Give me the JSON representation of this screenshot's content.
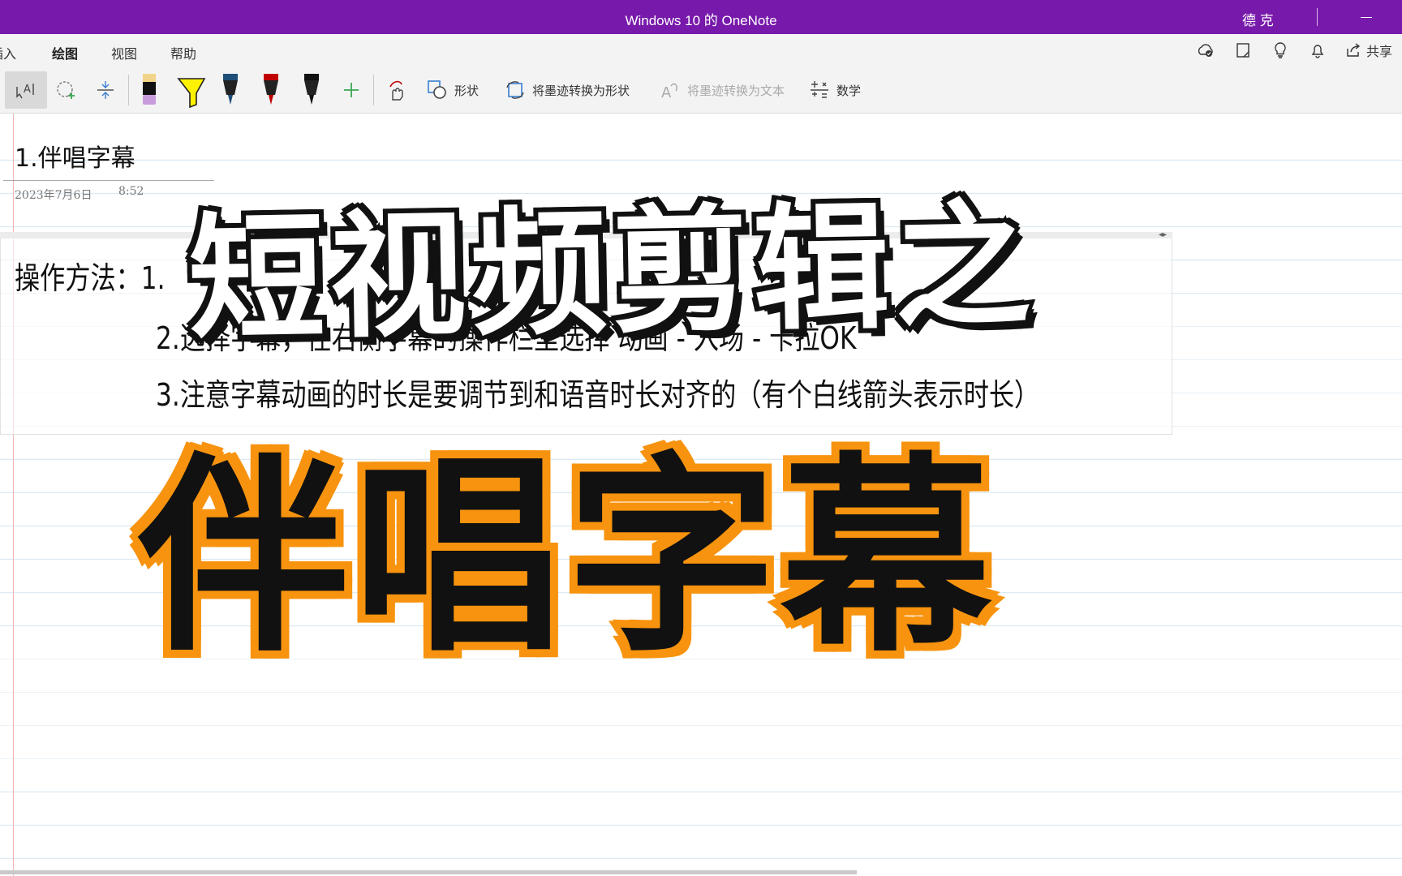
{
  "window": {
    "title": "Windows 10 的 OneNote",
    "user": "德 克"
  },
  "ribbon": {
    "tabs": [
      {
        "label": "插入"
      },
      {
        "label": "绘图"
      },
      {
        "label": "视图"
      },
      {
        "label": "帮助"
      }
    ],
    "active_tab": "绘图",
    "share_label": "共享"
  },
  "toolbar": {
    "shape_label": "形状",
    "ink_to_shape_label": "将墨迹转换为形状",
    "ink_to_text_label": "将墨迹转换为文本",
    "math_label": "数学",
    "pen_colors": [
      "#c79bdc",
      "#fff200",
      "#1f4e79",
      "#c00000",
      "#111111"
    ],
    "add_pen_color": "#3aa655"
  },
  "page": {
    "title": "1.伴唱字幕",
    "date": "2023年7月6日",
    "time": "8:52",
    "notes": [
      "操作方法：1.",
      "2.选择字幕，在右侧字幕的操作栏里选择 动画 - 入场 - 卡拉OK",
      "3.注意字幕动画的时长是要调节到和语音时长对齐的（有个白线箭头表示时长）"
    ]
  },
  "overlay": {
    "top_text": "短视频剪辑之",
    "bottom_text": "伴唱字幕",
    "bottom_stroke_color": "#f7930e"
  }
}
